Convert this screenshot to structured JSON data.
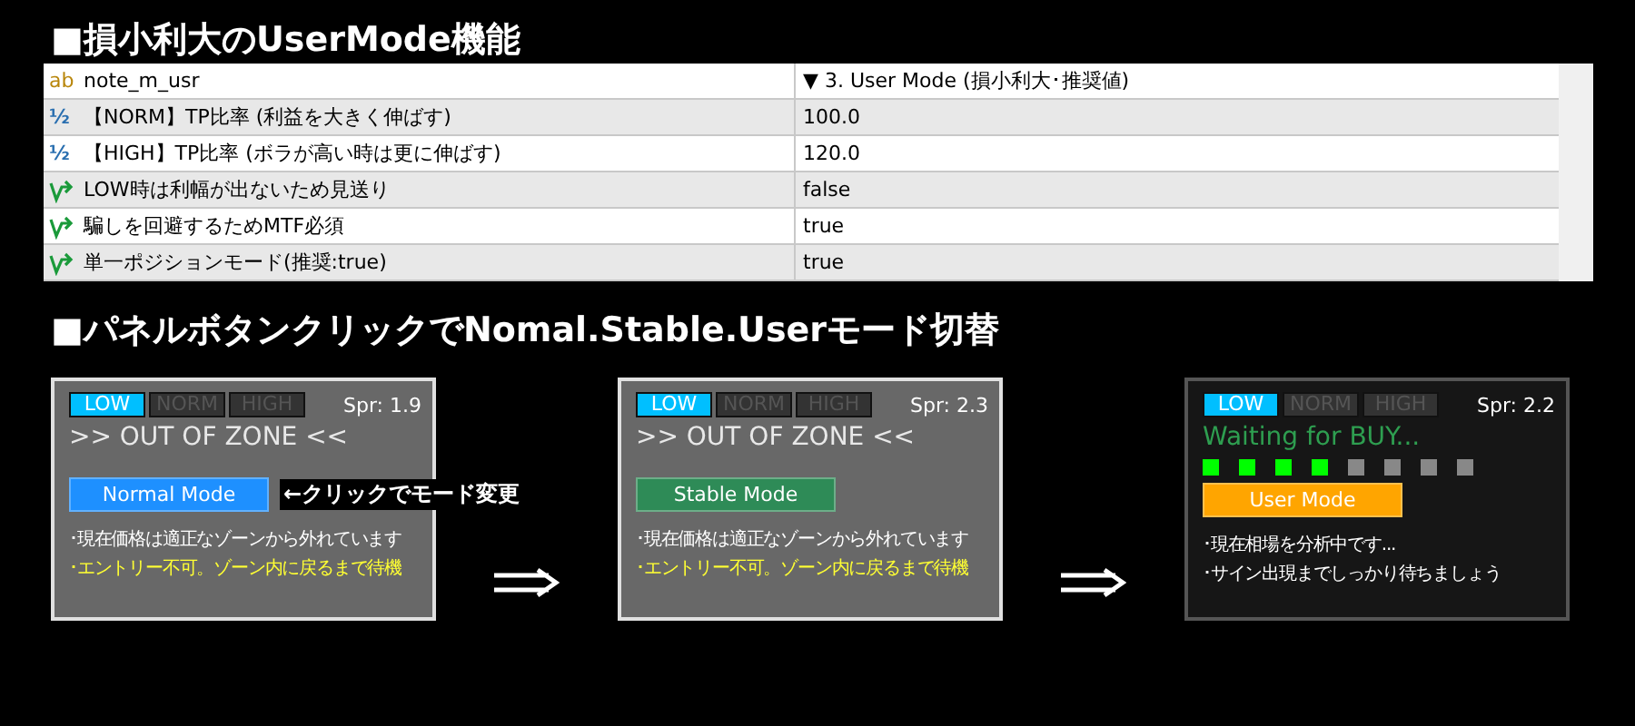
{
  "title": "■損小利大のUserMode機能",
  "table": {
    "rows": [
      {
        "kind": "text",
        "type_icon": "ab",
        "name": "note_m_usr",
        "value": "▼ 3. User Mode (損小利大･推奨値)"
      },
      {
        "kind": "number",
        "type_icon": "½",
        "name": "【NORM】TP比率 (利益を大きく伸ばす)",
        "value": "100.0"
      },
      {
        "kind": "number",
        "type_icon": "½",
        "name": "【HIGH】TP比率 (ボラが高い時は更に伸ばす)",
        "value": "120.0"
      },
      {
        "kind": "bool",
        "name": "LOW時は利幅が出ないため見送り",
        "value": "false"
      },
      {
        "kind": "bool",
        "name": "騙しを回避するためMTF必須",
        "value": "true"
      },
      {
        "kind": "bool",
        "name": "単一ポジションモード(推奨:true)",
        "value": "true"
      }
    ]
  },
  "section_title": "■パネルボタンクリックでNomal.Stable.Userモード切替",
  "panels": [
    {
      "kind": "light",
      "levels": [
        {
          "label": "LOW",
          "selected": true
        },
        {
          "label": "NORM",
          "selected": false
        },
        {
          "label": "HIGH",
          "selected": false
        }
      ],
      "spread": "Spr: 1.9",
      "status": {
        "kind": "zone",
        "text": ">> OUT OF ZONE <<"
      },
      "mode_button": {
        "label": "Normal Mode",
        "color": "#1e90ff"
      },
      "callout": "←クリックでモード変更",
      "notes": [
        {
          "kind": "info",
          "text": "･現在価格は適正なゾーンから外れています"
        },
        {
          "kind": "warning",
          "text": "･エントリー不可。ゾーン内に戻るまで待機"
        }
      ]
    },
    {
      "kind": "light",
      "levels": [
        {
          "label": "LOW",
          "selected": true
        },
        {
          "label": "NORM",
          "selected": false
        },
        {
          "label": "HIGH",
          "selected": false
        }
      ],
      "spread": "Spr: 2.3",
      "status": {
        "kind": "zone",
        "text": ">> OUT OF ZONE <<"
      },
      "mode_button": {
        "label": "Stable Mode",
        "color": "#2e8b57"
      },
      "notes": [
        {
          "kind": "info",
          "text": "･現在価格は適正なゾーンから外れています"
        },
        {
          "kind": "warning",
          "text": "･エントリー不可。ゾーン内に戻るまで待機"
        }
      ]
    },
    {
      "kind": "dark",
      "levels": [
        {
          "label": "LOW",
          "selected": true
        },
        {
          "label": "NORM",
          "selected": false
        },
        {
          "label": "HIGH",
          "selected": false
        }
      ],
      "spread": "Spr: 2.2",
      "status": {
        "kind": "waiting",
        "text": "Waiting for BUY..."
      },
      "signals": [
        {
          "on": true
        },
        {
          "on": true
        },
        {
          "on": true
        },
        {
          "on": true
        },
        {
          "on": false
        },
        {
          "on": false
        },
        {
          "on": false
        },
        {
          "on": false
        }
      ],
      "mode_button": {
        "label": "User Mode",
        "color": "#ffa500"
      },
      "notes": [
        {
          "kind": "info",
          "text": "･現在相場を分析中です..."
        },
        {
          "kind": "info",
          "text": "･サイン出現までしっかり待ちましょう"
        }
      ]
    }
  ]
}
